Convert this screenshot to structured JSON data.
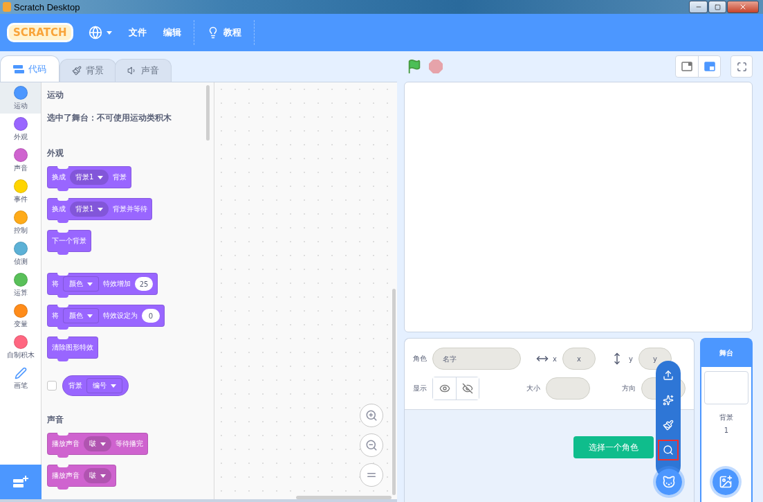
{
  "window": {
    "title": "Scratch Desktop"
  },
  "menu_bar": {
    "logo": "SCRATCH",
    "menus": [
      {
        "label": "文件"
      },
      {
        "label": "编辑"
      }
    ],
    "tutorials": "教程"
  },
  "editor_tabs": [
    {
      "label": "代码",
      "kind": "code",
      "selected": true
    },
    {
      "label": "背景",
      "kind": "brush",
      "selected": false
    },
    {
      "label": "声音",
      "kind": "sound",
      "selected": false
    }
  ],
  "categories": [
    {
      "label": "运动",
      "kind": "dot",
      "color": "#4c97ff",
      "selected": true
    },
    {
      "label": "外观",
      "kind": "dot",
      "color": "#9966ff",
      "selected": false
    },
    {
      "label": "声音",
      "kind": "dot",
      "color": "#cf63cf",
      "selected": false
    },
    {
      "label": "事件",
      "kind": "dot",
      "color": "#ffd500",
      "selected": false
    },
    {
      "label": "控制",
      "kind": "dot",
      "color": "#ffab19",
      "selected": false
    },
    {
      "label": "侦测",
      "kind": "dot",
      "color": "#5cb1d6",
      "selected": false
    },
    {
      "label": "运算",
      "kind": "dot",
      "color": "#59c059",
      "selected": false
    },
    {
      "label": "变量",
      "kind": "dot",
      "color": "#ff8c1a",
      "selected": false
    },
    {
      "label": "自制积木",
      "kind": "dot",
      "color": "#ff6680",
      "selected": false
    },
    {
      "label": "画笔",
      "kind": "pen",
      "selected": false
    }
  ],
  "palette": [
    {
      "kind": "heading",
      "text": "运动"
    },
    {
      "kind": "note",
      "text": "选中了舞台：不可使用运动类积木"
    },
    {
      "kind": "heading",
      "text": "外观"
    },
    {
      "kind": "block",
      "color": "#9966ff",
      "parts": [
        {
          "kind": "text",
          "text": "换成"
        },
        {
          "kind": "dropdown",
          "text": "背景1"
        },
        {
          "kind": "text",
          "text": "背景"
        }
      ]
    },
    {
      "kind": "block",
      "color": "#9966ff",
      "parts": [
        {
          "kind": "text",
          "text": "换成"
        },
        {
          "kind": "dropdown",
          "text": "背景1"
        },
        {
          "kind": "text",
          "text": "背景并等待"
        }
      ]
    },
    {
      "kind": "block",
      "color": "#9966ff",
      "parts": [
        {
          "kind": "text",
          "text": "下一个背景"
        }
      ]
    },
    {
      "kind": "block",
      "color": "#9966ff",
      "gap": true,
      "parts": [
        {
          "kind": "text",
          "text": "将"
        },
        {
          "kind": "menu",
          "text": "颜色"
        },
        {
          "kind": "text",
          "text": "特效增加"
        },
        {
          "kind": "number",
          "text": "25"
        }
      ]
    },
    {
      "kind": "block",
      "color": "#9966ff",
      "parts": [
        {
          "kind": "text",
          "text": "将"
        },
        {
          "kind": "menu",
          "text": "颜色"
        },
        {
          "kind": "text",
          "text": "特效设定为"
        },
        {
          "kind": "number",
          "text": "0"
        }
      ]
    },
    {
      "kind": "block",
      "color": "#9966ff",
      "parts": [
        {
          "kind": "text",
          "text": "清除图形特效"
        }
      ]
    },
    {
      "kind": "reporter",
      "color": "#9966ff",
      "checked": false,
      "parts": [
        {
          "kind": "text",
          "text": "背景"
        },
        {
          "kind": "menu",
          "text": "编号"
        }
      ]
    },
    {
      "kind": "heading",
      "text": "声音"
    },
    {
      "kind": "block",
      "color": "#cf63cf",
      "parts": [
        {
          "kind": "text",
          "text": "播放声音"
        },
        {
          "kind": "dropdown",
          "text": "啵"
        },
        {
          "kind": "text",
          "text": "等待播完"
        }
      ]
    },
    {
      "kind": "block",
      "color": "#cf63cf",
      "parts": [
        {
          "kind": "text",
          "text": "播放声音"
        },
        {
          "kind": "dropdown",
          "text": "啵"
        }
      ]
    }
  ],
  "stage_size_buttons": [
    {
      "kind": "small",
      "selected": false
    },
    {
      "kind": "normal",
      "selected": true
    }
  ],
  "sprite_info": {
    "sprite_label": "角色",
    "name_placeholder": "名字",
    "x_label": "x",
    "x_placeholder": "x",
    "y_label": "y",
    "y_placeholder": "y",
    "show_label": "显示",
    "visibility": [
      {
        "kind": "show",
        "selected": false
      },
      {
        "kind": "hide",
        "selected": false
      }
    ],
    "size_label": "大小",
    "direction_label": "方向"
  },
  "add_sprite_menu": {
    "tooltip": "选择一个角色",
    "items": [
      {
        "kind": "upload",
        "highlighted": false
      },
      {
        "kind": "surprise",
        "highlighted": false
      },
      {
        "kind": "paint",
        "highlighted": false
      },
      {
        "kind": "search",
        "highlighted": true
      }
    ]
  },
  "stage_pane": {
    "title": "舞台",
    "backdrops_label": "背景",
    "backdrop_count": "1"
  }
}
